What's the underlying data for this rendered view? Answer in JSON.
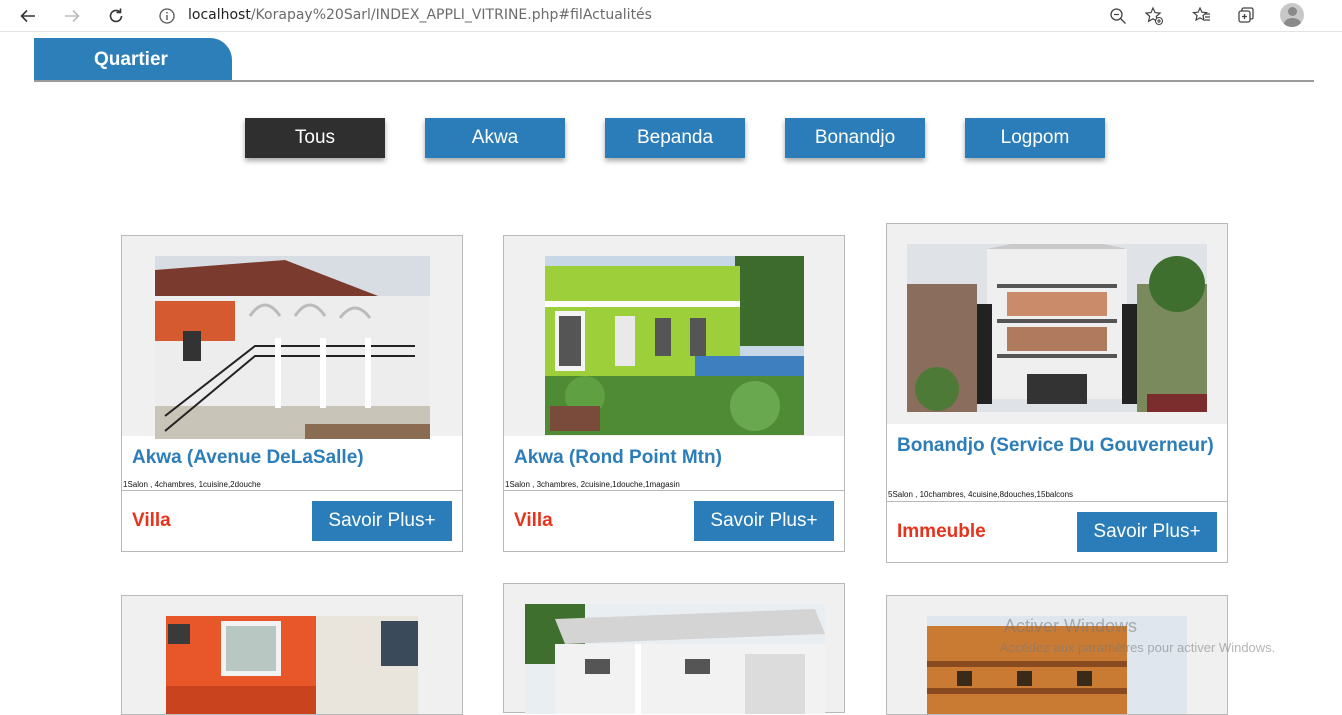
{
  "browser": {
    "url_host": "localhost",
    "url_path": "/Korapay%20Sarl/INDEX_APPLI_VITRINE.php#filActualités"
  },
  "section": {
    "title": "Quartier"
  },
  "filters": [
    {
      "label": "Tous",
      "active": true
    },
    {
      "label": "Akwa",
      "active": false
    },
    {
      "label": "Bepanda",
      "active": false
    },
    {
      "label": "Bonandjo",
      "active": false
    },
    {
      "label": "Logpom",
      "active": false
    }
  ],
  "cards": [
    {
      "title": "Akwa (Avenue DeLaSalle)",
      "features": "1Salon , 4chambres, 1cuisine,2douche",
      "type": "Villa",
      "button": "Savoir Plus+"
    },
    {
      "title": "Akwa (Rond Point Mtn)",
      "features": "1Salon , 3chambres, 2cuisine,1douche,1magasin",
      "type": "Villa",
      "button": "Savoir Plus+"
    },
    {
      "title": "Bonandjo (Service Du Gouverneur)",
      "features": "5Salon , 10chambres, 4cuisine,8douches,15balcons",
      "type": "Immeuble",
      "button": "Savoir Plus+"
    }
  ],
  "watermark": {
    "line1": "Activer Windows",
    "line2": "Accédez aux paramètres pour activer Windows."
  },
  "colors": {
    "primary": "#2a7db8",
    "active": "#2f2f2f",
    "type_red": "#e8331c"
  },
  "icons": [
    "back-arrow-icon",
    "forward-arrow-icon",
    "reload-icon",
    "info-icon",
    "zoom-out-icon",
    "add-favorite-icon",
    "favorites-icon",
    "collections-icon",
    "profile-icon"
  ]
}
